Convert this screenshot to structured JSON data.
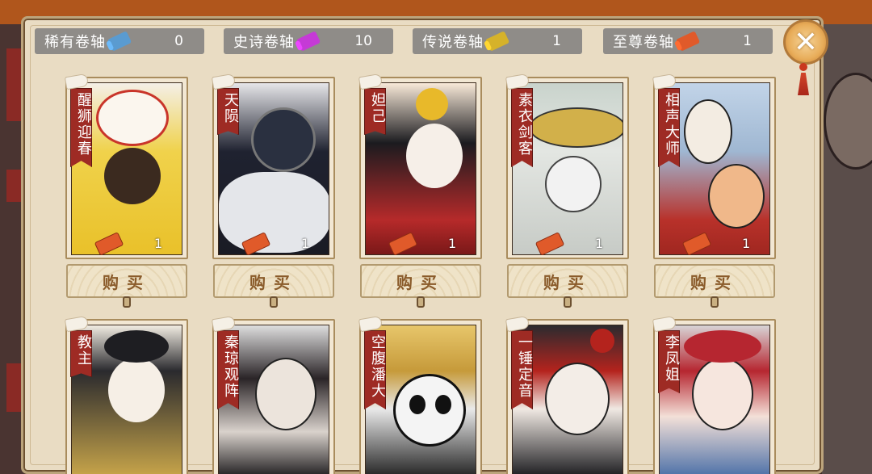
{
  "currencies": [
    {
      "label": "稀有卷轴",
      "count": "0",
      "color": "#5a9bd0",
      "icon": "rare-scroll-icon"
    },
    {
      "label": "史诗卷轴",
      "count": "10",
      "color": "#c53ad6",
      "icon": "epic-scroll-icon"
    },
    {
      "label": "传说卷轴",
      "count": "1",
      "color": "#d6b22a",
      "icon": "legend-scroll-icon"
    },
    {
      "label": "至尊卷轴",
      "count": "1",
      "color": "#e05a2a",
      "icon": "supreme-scroll-icon"
    }
  ],
  "close_label": "✕",
  "buy_label": "购买",
  "cards": [
    {
      "name": "醒狮迎春",
      "owned": "1"
    },
    {
      "name": "天陨",
      "owned": "1"
    },
    {
      "name": "妲己",
      "owned": "1"
    },
    {
      "name": "素衣剑客",
      "owned": "1"
    },
    {
      "name": "相声大师",
      "owned": "1"
    },
    {
      "name": "教主"
    },
    {
      "name": "秦琼观阵"
    },
    {
      "name": "空腹潘大"
    },
    {
      "name": "一锤定音"
    },
    {
      "name": "李凤姐"
    }
  ],
  "colors": {
    "panel": "#e9dcc3",
    "banner": "#9e2b24",
    "currency_bar": "#8f8c88",
    "button_text": "#8a5b2a"
  }
}
